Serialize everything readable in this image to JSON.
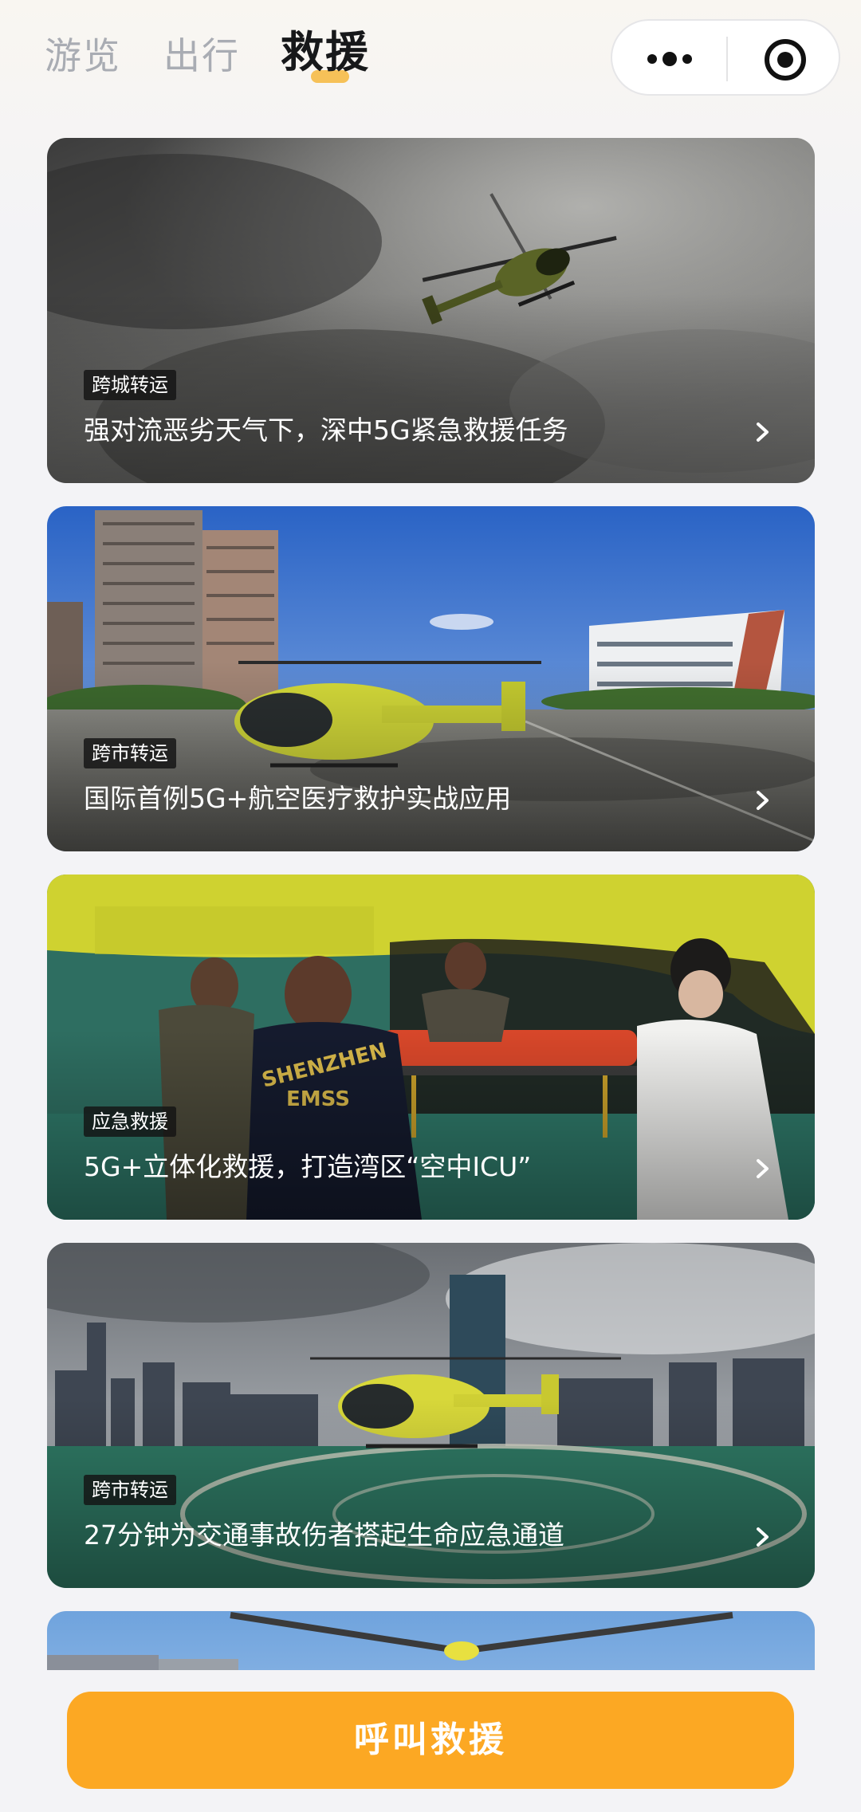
{
  "header": {
    "tabs": [
      {
        "label": "游览",
        "active": false
      },
      {
        "label": "出行",
        "active": false
      },
      {
        "label": "救援",
        "active": true
      }
    ],
    "accent_color": "#f6b73c",
    "capsule": {
      "more_icon": "more-dots-icon",
      "close_icon": "target-circle-icon"
    }
  },
  "cards": [
    {
      "tag": "跨城转运",
      "title": "强对流恶劣天气下，深中5G紧急救援任务",
      "image": "helicopter-in-storm-clouds"
    },
    {
      "tag": "跨市转运",
      "title": "国际首例5G+航空医疗救护实战应用",
      "image": "yellow-helicopter-on-hospital-plaza"
    },
    {
      "tag": "应急救援",
      "title": "5G+立体化救援，打造湾区“空中ICU”",
      "image": "medics-loading-stretcher-into-helicopter"
    },
    {
      "tag": "跨市转运",
      "title": "27分钟为交通事故伤者搭起生命应急通道",
      "image": "helicopter-on-rooftop-helipad"
    },
    {
      "tag": "",
      "title": "",
      "image": "helicopter-rotor-partial"
    }
  ],
  "cta": {
    "label": "呼叫救援",
    "color": "#fca823"
  }
}
